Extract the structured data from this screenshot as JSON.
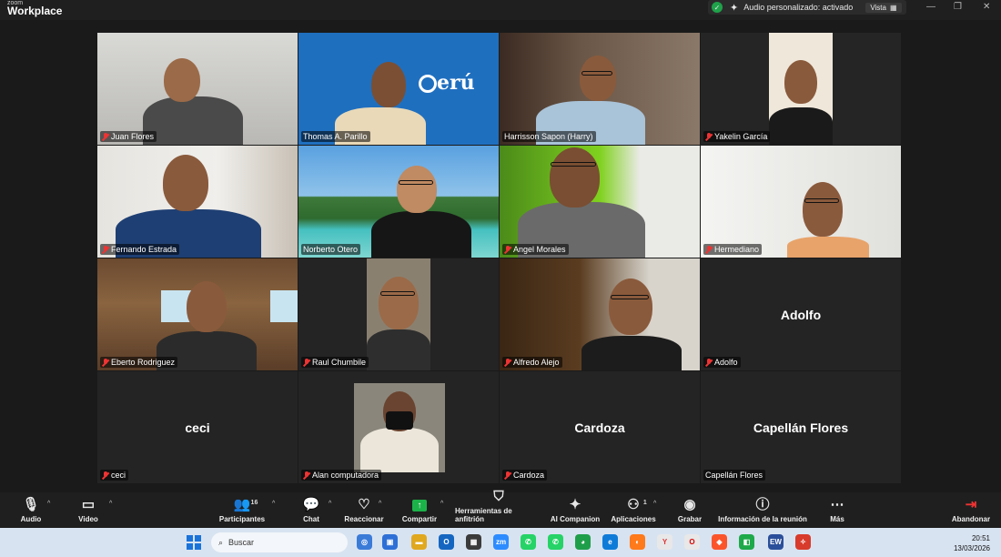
{
  "app": {
    "brand_small": "zoom",
    "brand": "Workplace"
  },
  "status_bar": {
    "audio_status": "Audio personalizado: activado",
    "view_label": "Vista"
  },
  "participants": [
    {
      "name": "Juan Flores",
      "muted": true
    },
    {
      "name": "Thomas A. Parillo",
      "muted": false
    },
    {
      "name": "Harrisson Sapon (Harry)",
      "muted": false
    },
    {
      "name": "Yakelin García",
      "muted": true
    },
    {
      "name": "Fernando Estrada",
      "muted": true
    },
    {
      "name": "Norberto Otero",
      "muted": false,
      "active_speaker": true
    },
    {
      "name": "Angel Morales",
      "muted": true
    },
    {
      "name": "Hermediano",
      "muted": true
    },
    {
      "name": "Eberto Rodriguez",
      "muted": true
    },
    {
      "name": "Raul Chumbile",
      "muted": true
    },
    {
      "name": "Alfredo Alejo",
      "muted": true
    },
    {
      "name": "Adolfo",
      "muted": true,
      "video_off": true,
      "display_name": "Adolfo"
    },
    {
      "name": "ceci",
      "muted": true,
      "video_off": true,
      "display_name": "ceci"
    },
    {
      "name": "Alan computadora",
      "muted": true
    },
    {
      "name": "Cardoza",
      "muted": true,
      "video_off": true,
      "display_name": "Cardoza"
    },
    {
      "name": "Capellán Flores",
      "muted": false,
      "video_off": true,
      "display_name": "Capellán Flores"
    }
  ],
  "logo_text": "erú",
  "toolbar": {
    "audio": "Audio",
    "video": "Video",
    "participants": "Participantes",
    "participants_count": "16",
    "chat": "Chat",
    "react": "Reaccionar",
    "share": "Compartir",
    "host_tools": "Herramientas de anfitrión",
    "ai_companion": "AI Companion",
    "apps": "Aplicaciones",
    "apps_count": "1",
    "record": "Grabar",
    "meeting_info": "Información de la reunión",
    "more": "Más",
    "leave": "Abandonar"
  },
  "taskbar": {
    "search_placeholder": "Buscar",
    "time": "20:51",
    "date": "13/03/2026"
  },
  "colors": {
    "accent_green": "#2fd58a",
    "mute_red": "#e33333",
    "share_green": "#1cb24a"
  }
}
